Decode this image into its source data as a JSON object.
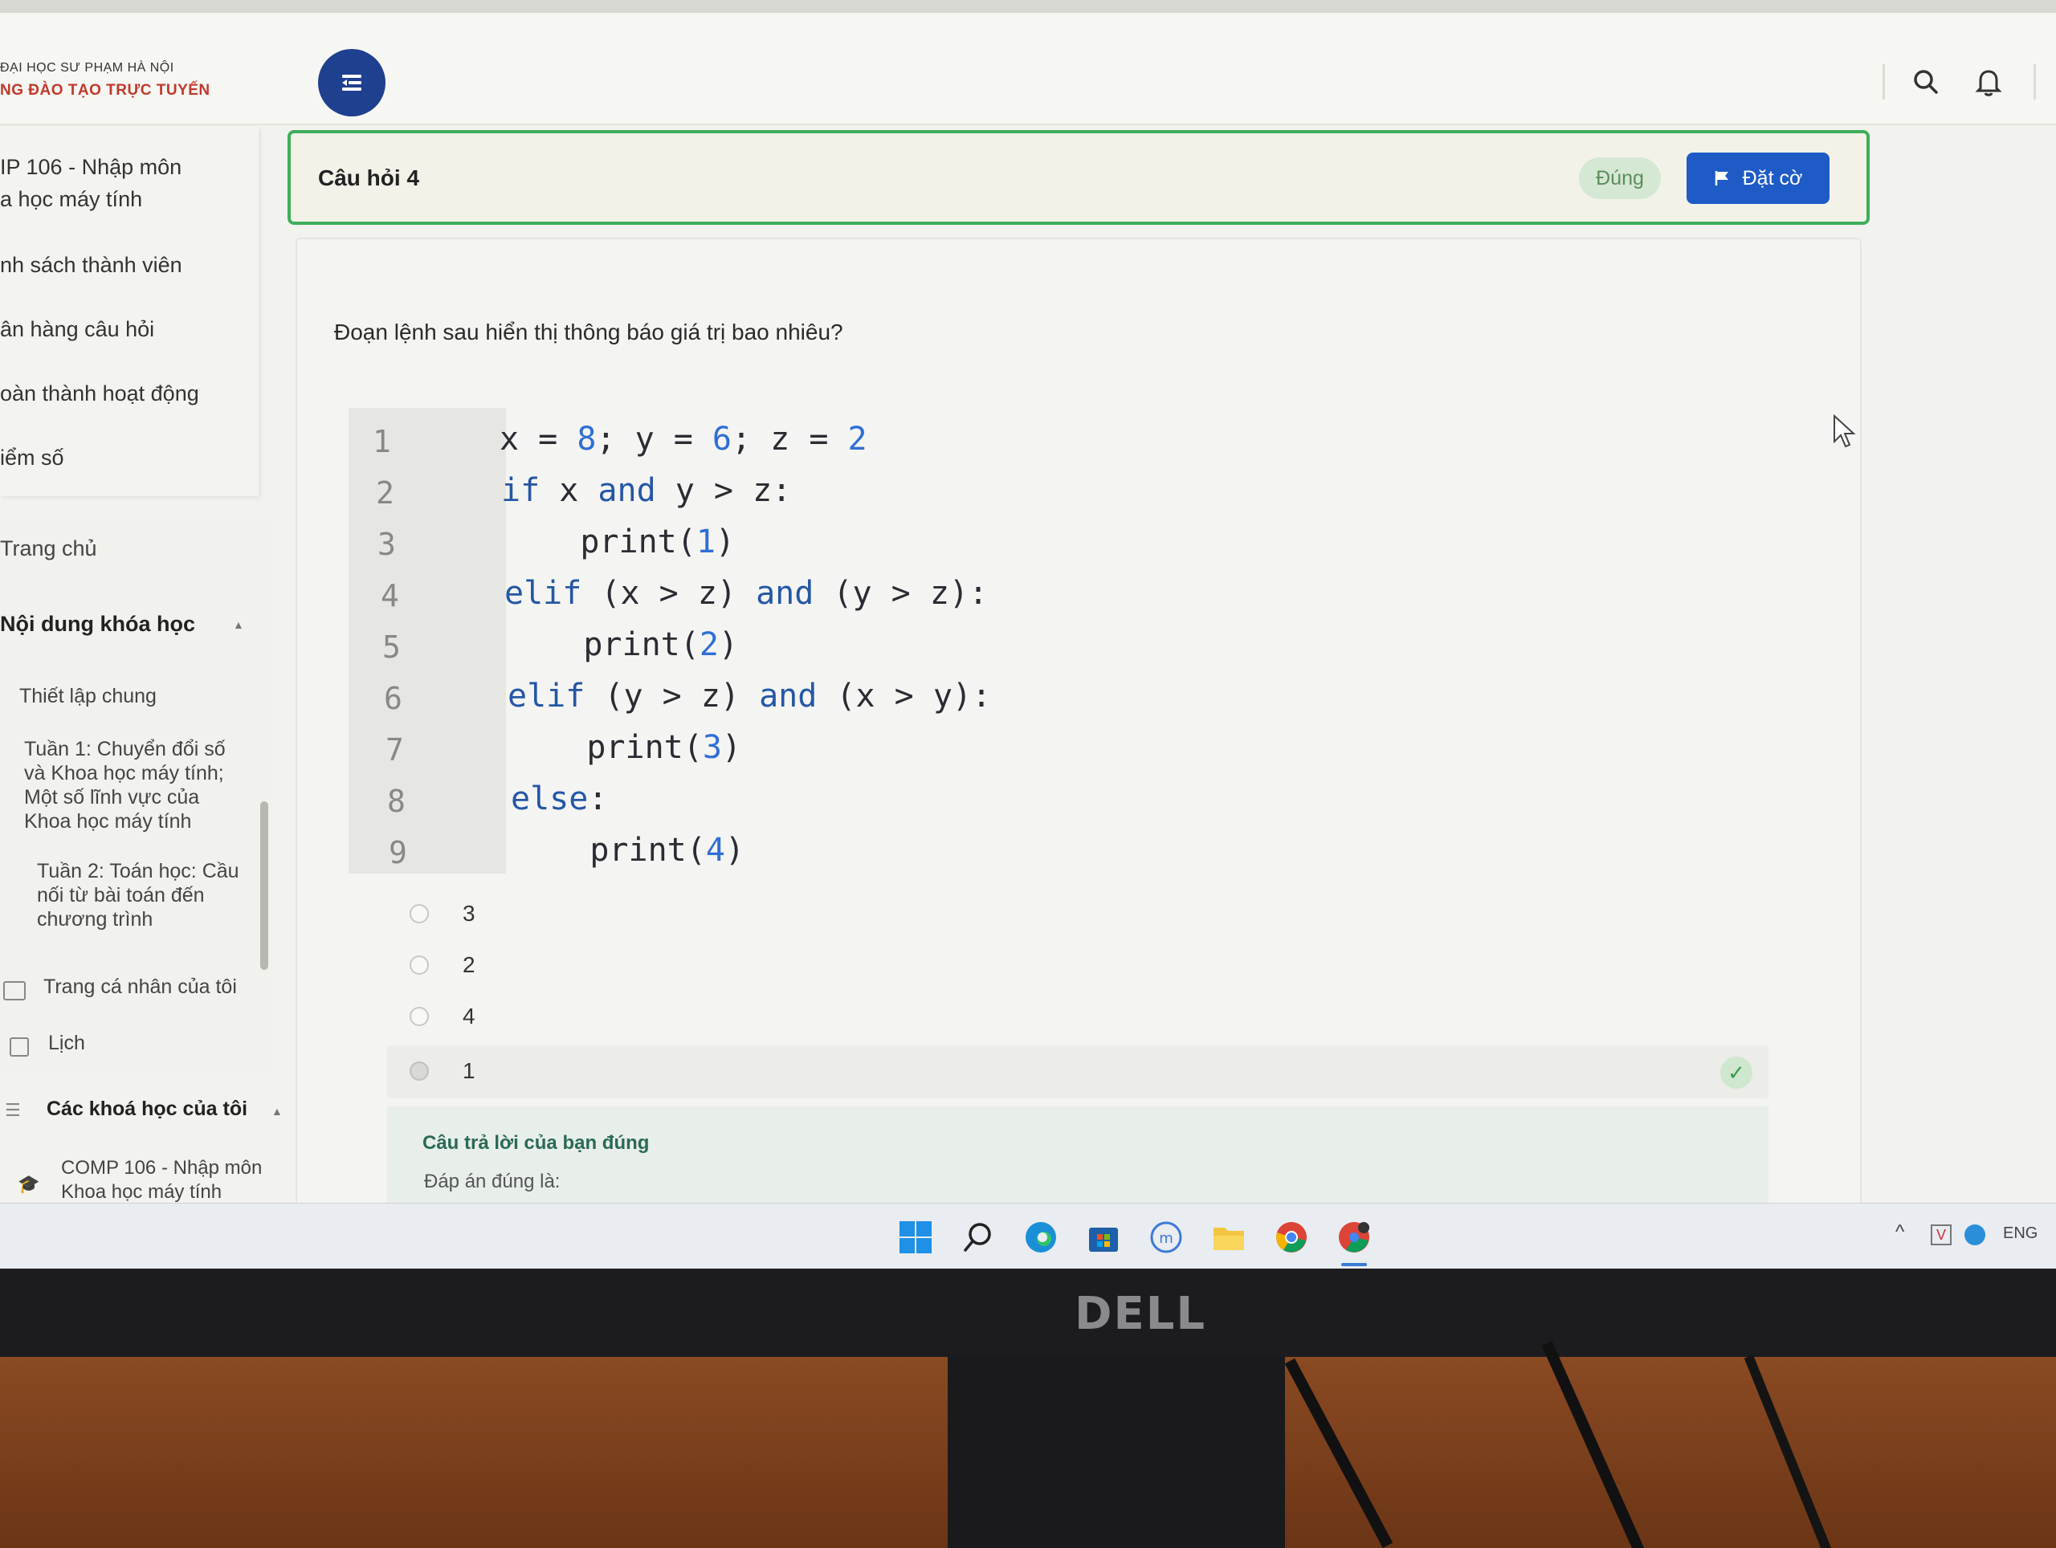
{
  "header": {
    "brand_line1": "ĐẠI HỌC SƯ PHẠM HÀ NỘI",
    "brand_line2": "NG ĐÀO TẠO TRỰC TUYẾN"
  },
  "sidebar": {
    "course_card": {
      "title_line1": "IP 106 - Nhập môn",
      "title_line2": "a học máy tính",
      "links": [
        "nh sách thành viên",
        "ân hàng câu hỏi",
        "oàn thành hoạt động",
        "iểm số"
      ]
    },
    "home": "Trang chủ",
    "course_content": "Nội dung khóa học",
    "sections": [
      {
        "lines": [
          "Thiết lập chung"
        ]
      },
      {
        "lines": [
          "Tuần 1: Chuyển đổi số",
          "và Khoa học máy tính;",
          "Một số lĩnh vực của",
          "Khoa học máy tính"
        ]
      },
      {
        "lines": [
          "Tuần 2: Toán học: Cầu",
          "nối từ bài toán đến",
          "chương trình"
        ]
      }
    ],
    "profile": "Trang cá nhân của tôi",
    "calendar": "Lịch",
    "my_courses": "Các khoá học của tôi",
    "my_course_item": [
      "COMP 106 - Nhập môn",
      "Khoa học máy tính"
    ]
  },
  "question": {
    "title": "Câu hỏi 4",
    "status_badge": "Đúng",
    "flag_label": "Đặt cờ",
    "text": "Đoạn lệnh sau hiển thị thông báo giá trị bao nhiêu?",
    "line_numbers": [
      "1",
      "2",
      "3",
      "4",
      "5",
      "6",
      "7",
      "8",
      "9"
    ],
    "options": [
      "3",
      "2",
      "4",
      "1"
    ],
    "feedback_correct": "Câu trả lời của bạn đúng",
    "feedback_answer": "Đáp án đúng là:"
  },
  "taskbar": {
    "tray_lang": "ENG"
  },
  "monitor": {
    "brand": "DELL"
  },
  "colors": {
    "accent_blue": "#1e5bc6",
    "menu_button": "#1f3f8f",
    "correct_green": "#3fae5a",
    "brand_red": "#c0392b"
  }
}
